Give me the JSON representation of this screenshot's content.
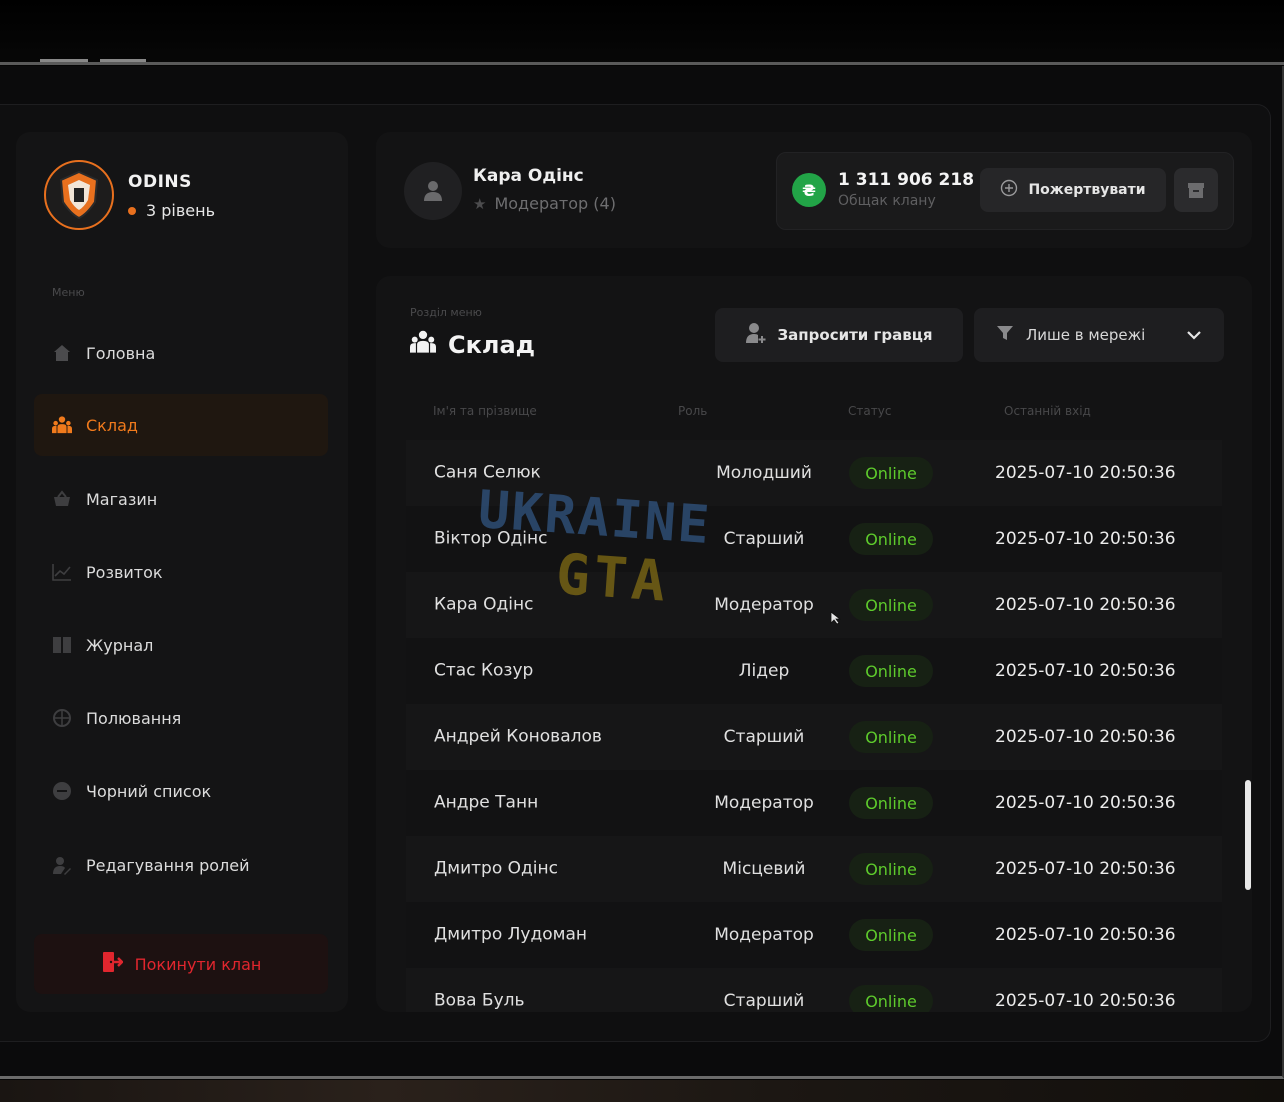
{
  "clan": {
    "name": "ODINS",
    "level": "3 рівень"
  },
  "sidebar": {
    "caption": "Меню",
    "items": [
      {
        "label": "Головна",
        "icon": "home-icon"
      },
      {
        "label": "Склад",
        "icon": "group-icon",
        "active": true
      },
      {
        "label": "Магазин",
        "icon": "basket-icon"
      },
      {
        "label": "Розвиток",
        "icon": "chart-icon"
      },
      {
        "label": "Журнал",
        "icon": "book-icon"
      },
      {
        "label": "Полювання",
        "icon": "crosshair-icon"
      },
      {
        "label": "Чорний список",
        "icon": "block-icon"
      },
      {
        "label": "Редагування ролей",
        "icon": "user-edit-icon"
      }
    ],
    "leave_label": "Покинути клан"
  },
  "user": {
    "name": "Кара Одінс",
    "role": "Модератор (4)"
  },
  "treasury": {
    "coin_symbol": "₴",
    "balance": "1 311 906 218",
    "label": "Общак клану",
    "donate_label": "Пожертвувати"
  },
  "section": {
    "caption": "Розділ меню",
    "title": "Склад",
    "invite_label": "Запросити гравця",
    "filter_value": "Лише в мережі"
  },
  "table": {
    "columns": [
      "Ім'я та прізвище",
      "Роль",
      "Статус",
      "Останній вхід"
    ],
    "rows": [
      {
        "name": "Саня Селюк",
        "role": "Молодший",
        "status": "Online",
        "last": "2025-07-10 20:50:36"
      },
      {
        "name": "Віктор Одінс",
        "role": "Старший",
        "status": "Online",
        "last": "2025-07-10 20:50:36"
      },
      {
        "name": "Кара Одінс",
        "role": "Модератор",
        "status": "Online",
        "last": "2025-07-10 20:50:36"
      },
      {
        "name": "Стас Козур",
        "role": "Лідер",
        "status": "Online",
        "last": "2025-07-10 20:50:36"
      },
      {
        "name": "Андрей Коновалов",
        "role": "Старший",
        "status": "Online",
        "last": "2025-07-10 20:50:36"
      },
      {
        "name": "Андре Танн",
        "role": "Модератор",
        "status": "Online",
        "last": "2025-07-10 20:50:36"
      },
      {
        "name": "Дмитро Одінс",
        "role": "Місцевий",
        "status": "Online",
        "last": "2025-07-10 20:50:36"
      },
      {
        "name": "Дмитро Лудоман",
        "role": "Модератор",
        "status": "Online",
        "last": "2025-07-10 20:50:36"
      },
      {
        "name": "Вова Буль",
        "role": "Старший",
        "status": "Online",
        "last": "2025-07-10 20:50:36"
      }
    ]
  },
  "watermark": {
    "line1": "UKRAINE",
    "line2": "GTA"
  },
  "colors": {
    "accent": "#f07a1c",
    "online": "#5ecb2c",
    "danger": "#e0262e",
    "coin": "#22a447"
  }
}
